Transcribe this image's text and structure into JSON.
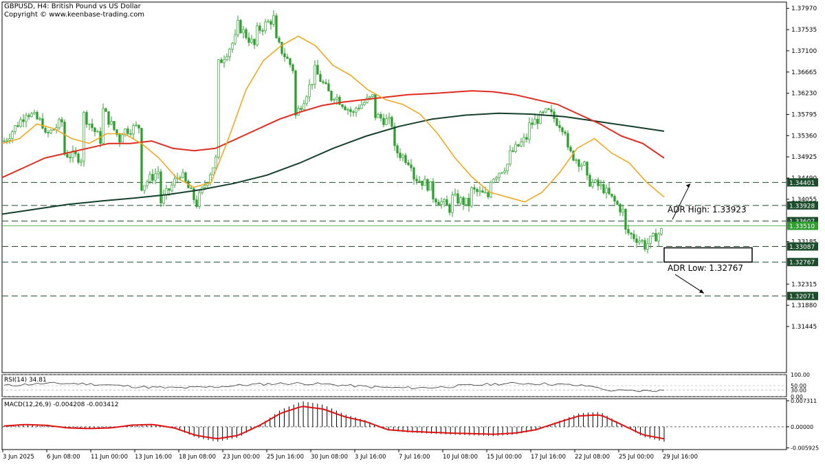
{
  "header": {
    "title": "GBPUSD, H4:  British Pound vs US Dollar",
    "copyright": "Copyright © www.keenbase-trading.com"
  },
  "rsi": {
    "title": "RSI(14) 34.81",
    "value": 34.81,
    "levels": [
      "100.00",
      "50.00",
      "30.00",
      "0.00"
    ]
  },
  "macd": {
    "title": "MACD(12,26,9) -0.004208 -0.003412",
    "ticks": [
      "0.007311",
      "0.00000",
      "-0.005925"
    ]
  },
  "colors": {
    "candle": "#2e9e2e",
    "ma_fast": "#f0a820",
    "ma_mid": "#e02a1e",
    "ma_slow": "#123f2a",
    "level_box": "#1b4d2c",
    "macd_signal": "#e01010"
  },
  "annotations": {
    "adr_high": "ADR High: 1.33923",
    "adr_low": "ADR Low: 1.32767"
  },
  "chart_data": {
    "type": "candlestick",
    "symbol": "GBPUSD",
    "timeframe": "H4",
    "ylim": [
      1.305,
      1.381
    ],
    "y_ticks": [
      "1.37970",
      "1.37535",
      "1.37100",
      "1.36665",
      "1.36230",
      "1.35795",
      "1.35360",
      "1.34925",
      "1.34490",
      "1.34055",
      "1.33185",
      "1.32315",
      "1.31880",
      "1.31445"
    ],
    "x_labels": [
      "3 Jun 2025",
      "6 Jun 08:00",
      "11 Jun 00:00",
      "13 Jun 16:00",
      "18 Jun 08:00",
      "23 Jun 00:00",
      "25 Jun 16:00",
      "30 Jun 08:00",
      "3 Jul 16:00",
      "7 Jul 16:00",
      "10 Jul 08:00",
      "15 Jul 00:00",
      "17 Jul 16:00",
      "22 Jul 08:00",
      "25 Jul 00:00",
      "29 Jul 16:00"
    ],
    "levels": [
      {
        "value": 1.34401,
        "label": "1.34401"
      },
      {
        "value": 1.33928,
        "label": "1.33928"
      },
      {
        "value": 1.33607,
        "label": "1.33607"
      },
      {
        "value": 1.33087,
        "label": "1.33087"
      },
      {
        "value": 1.32767,
        "label": "1.32767"
      },
      {
        "value": 1.32071,
        "label": "1.32071"
      }
    ],
    "current_price": {
      "value": 1.3351,
      "label": "1.33510"
    },
    "swings": [
      [
        1.3525,
        1.3575
      ],
      [
        1.359,
        1.356
      ],
      [
        1.353,
        1.3565
      ],
      [
        1.35,
        1.349
      ],
      [
        1.3585,
        1.3525
      ],
      [
        1.3595,
        1.3525
      ],
      [
        1.3545,
        1.3555
      ],
      [
        1.343,
        1.3465
      ],
      [
        1.3395,
        1.3455
      ],
      [
        1.3465,
        1.339
      ],
      [
        1.3405,
        1.3495
      ],
      [
        1.368,
        1.374
      ],
      [
        1.3765,
        1.3715
      ],
      [
        1.375,
        1.378
      ],
      [
        1.373,
        1.3665
      ],
      [
        1.3575,
        1.366
      ],
      [
        1.367,
        1.3605
      ],
      [
        1.362,
        1.358
      ],
      [
        1.359,
        1.3615
      ],
      [
        1.358,
        1.356
      ],
      [
        1.351,
        1.348
      ],
      [
        1.3455,
        1.343
      ],
      [
        1.3415,
        1.3385
      ],
      [
        1.341,
        1.3395
      ],
      [
        1.3425,
        1.341
      ],
      [
        1.3445,
        1.348
      ],
      [
        1.3495,
        1.3535
      ],
      [
        1.3555,
        1.3585
      ],
      [
        1.3585,
        1.3545
      ],
      [
        1.3505,
        1.347
      ],
      [
        1.3445,
        1.3425
      ],
      [
        1.342,
        1.3375
      ],
      [
        1.334,
        1.3315
      ],
      [
        1.331,
        1.3345
      ]
    ],
    "ma_fast": [
      1.352,
      1.353,
      1.356,
      1.355,
      1.353,
      1.352,
      1.354,
      1.354,
      1.352,
      1.349,
      1.345,
      1.343,
      1.344,
      1.353,
      1.363,
      1.369,
      1.372,
      1.374,
      1.372,
      1.368,
      1.366,
      1.363,
      1.361,
      1.36,
      1.358,
      1.354,
      1.349,
      1.345,
      1.342,
      1.341,
      1.34,
      1.342,
      1.346,
      1.351,
      1.353,
      1.35,
      1.348,
      1.344,
      1.341
    ],
    "ma_mid": [
      1.345,
      1.347,
      1.349,
      1.35,
      1.351,
      1.352,
      1.352,
      1.3525,
      1.351,
      1.3505,
      1.351,
      1.353,
      1.355,
      1.357,
      1.3585,
      1.3598,
      1.3605,
      1.361,
      1.3615,
      1.362,
      1.3622,
      1.3625,
      1.3628,
      1.3626,
      1.362,
      1.361,
      1.36,
      1.358,
      1.356,
      1.3535,
      1.352,
      1.349
    ],
    "ma_slow": [
      1.3375,
      1.3385,
      1.3395,
      1.3402,
      1.3408,
      1.3415,
      1.3425,
      1.3438,
      1.3455,
      1.348,
      1.351,
      1.3535,
      1.3555,
      1.357,
      1.3578,
      1.3582,
      1.358,
      1.3575,
      1.3565,
      1.3555,
      1.3545
    ]
  }
}
